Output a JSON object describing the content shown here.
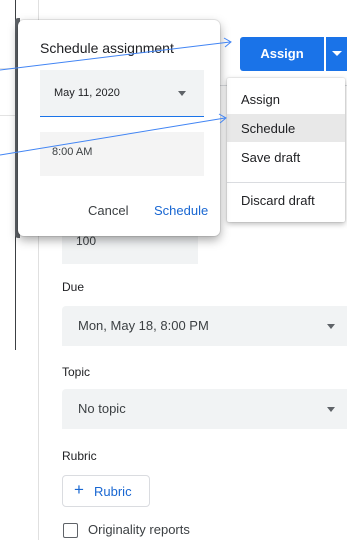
{
  "form": {
    "points_value": "100",
    "due_label": "Due",
    "due_value": "Mon, May 18, 8:00 PM",
    "topic_label": "Topic",
    "topic_value": "No topic",
    "rubric_label": "Rubric",
    "rubric_button": "Rubric",
    "originality_label": "Originality reports"
  },
  "assign_button": {
    "label": "Assign"
  },
  "menu": {
    "items": [
      "Assign",
      "Schedule",
      "Save draft",
      "Discard draft"
    ],
    "highlighted": "Schedule"
  },
  "dialog": {
    "title": "Schedule assignment",
    "date_value": "May 11, 2020",
    "time_value": "8:00 AM",
    "cancel_label": "Cancel",
    "schedule_label": "Schedule"
  },
  "colors": {
    "accent": "#1a73e8",
    "link": "#1967d2",
    "field_bg": "#f1f3f4",
    "annotation_line": "#4285f4"
  },
  "icons": {
    "plus": "plus-icon",
    "dropdown": "chevron-down-icon"
  }
}
